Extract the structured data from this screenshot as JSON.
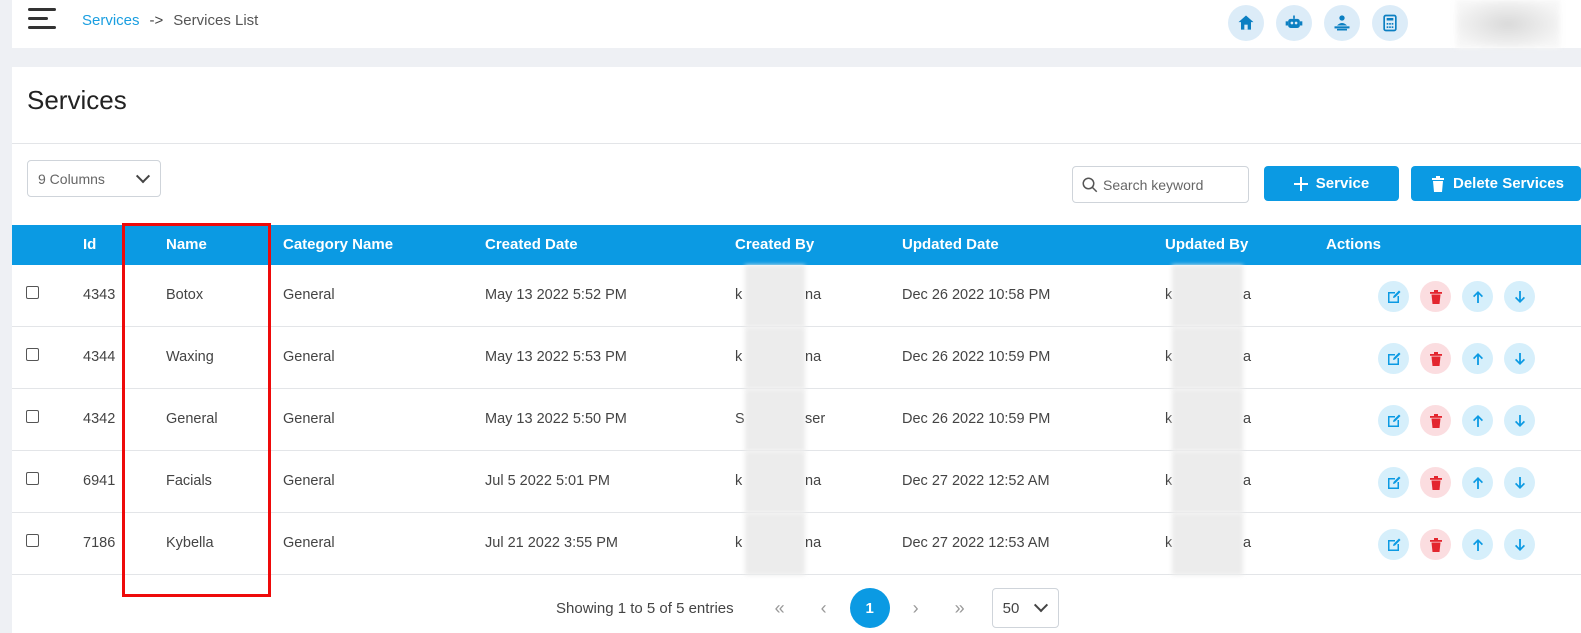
{
  "breadcrumb": {
    "link": "Services",
    "separator": "->",
    "current": "Services List"
  },
  "header_icons": [
    "home-icon",
    "robot-icon",
    "staff-icon",
    "calculator-icon"
  ],
  "page": {
    "title": "Services"
  },
  "toolbar": {
    "columns_select": "9 Columns",
    "search_placeholder": "Search keyword",
    "add_button": "Service",
    "delete_button": "Delete Services"
  },
  "table": {
    "headers": [
      "Id",
      "Name",
      "Category Name",
      "Created Date",
      "Created By",
      "Updated Date",
      "Updated By",
      "Actions"
    ],
    "rows": [
      {
        "id": "4343",
        "name": "Botox",
        "category": "General",
        "created_date": "May 13 2022 5:52 PM",
        "created_by_start": "k",
        "created_by_end": "na",
        "updated_date": "Dec 26 2022 10:58 PM",
        "updated_by_start": "k",
        "updated_by_end": "a"
      },
      {
        "id": "4344",
        "name": "Waxing",
        "category": "General",
        "created_date": "May 13 2022 5:53 PM",
        "created_by_start": "k",
        "created_by_end": "na",
        "updated_date": "Dec 26 2022 10:59 PM",
        "updated_by_start": "k",
        "updated_by_end": "a"
      },
      {
        "id": "4342",
        "name": "General",
        "category": "General",
        "created_date": "May 13 2022 5:50 PM",
        "created_by_start": "S",
        "created_by_end": "ser",
        "updated_date": "Dec 26 2022 10:59 PM",
        "updated_by_start": "k",
        "updated_by_end": "a"
      },
      {
        "id": "6941",
        "name": "Facials",
        "category": "General",
        "created_date": "Jul 5 2022 5:01 PM",
        "created_by_start": "k",
        "created_by_end": "na",
        "updated_date": "Dec 27 2022 12:52 AM",
        "updated_by_start": "k",
        "updated_by_end": "a"
      },
      {
        "id": "7186",
        "name": "Kybella",
        "category": "General",
        "created_date": "Jul 21 2022 3:55 PM",
        "created_by_start": "k",
        "created_by_end": "na",
        "updated_date": "Dec 27 2022 12:53 AM",
        "updated_by_start": "k",
        "updated_by_end": "a"
      }
    ]
  },
  "pagination": {
    "info": "Showing 1 to 5 of 5 entries",
    "first": "«",
    "prev": "‹",
    "current_page": "1",
    "next": "›",
    "last": "»",
    "page_size": "50"
  },
  "colors": {
    "primary": "#0b9ae3",
    "danger": "#e3262f",
    "highlight": "#ee0a0a"
  }
}
